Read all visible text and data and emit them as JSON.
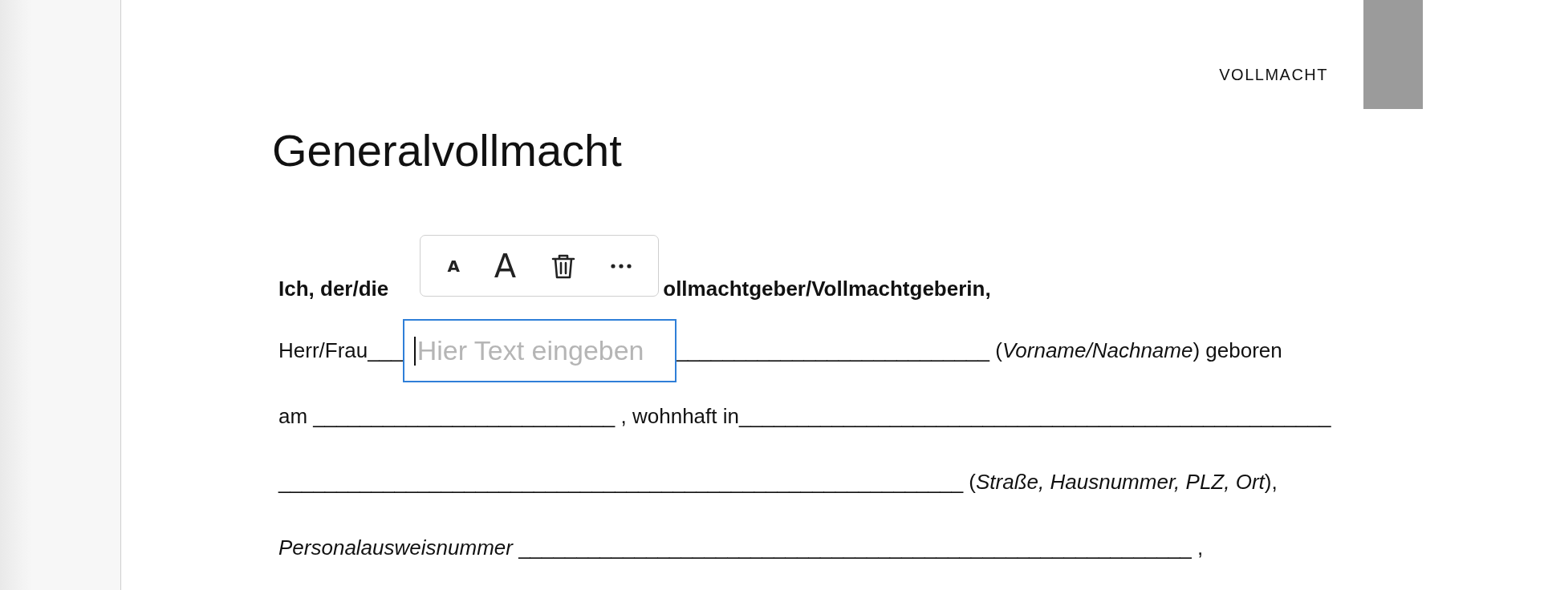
{
  "header": {
    "label": "VOLLMACHT"
  },
  "title": "Generalvollmacht",
  "intro": {
    "start": "Ich, der/die",
    "end": "ollmachtgeber/Vollmachtgeberin,"
  },
  "name_line": {
    "before": "Herr/Frau___",
    "field": {
      "placeholder": "Hier Text eingeben"
    },
    "after": "___________________________ (*Vorname/Nachname*) geboren"
  },
  "lines": [
    "am __________________________ , wohnhaft in___________________________________________________",
    "___________________________________________________________ (*Straße, Hausnummer, PLZ, Ort*),",
    "*Personalausweisnummer* __________________________________________________________ ,"
  ],
  "toolbar": [
    {
      "kind": "smaller",
      "label": "A"
    },
    {
      "kind": "larger",
      "label": "A"
    },
    {
      "kind": "delete"
    },
    {
      "kind": "more"
    }
  ]
}
